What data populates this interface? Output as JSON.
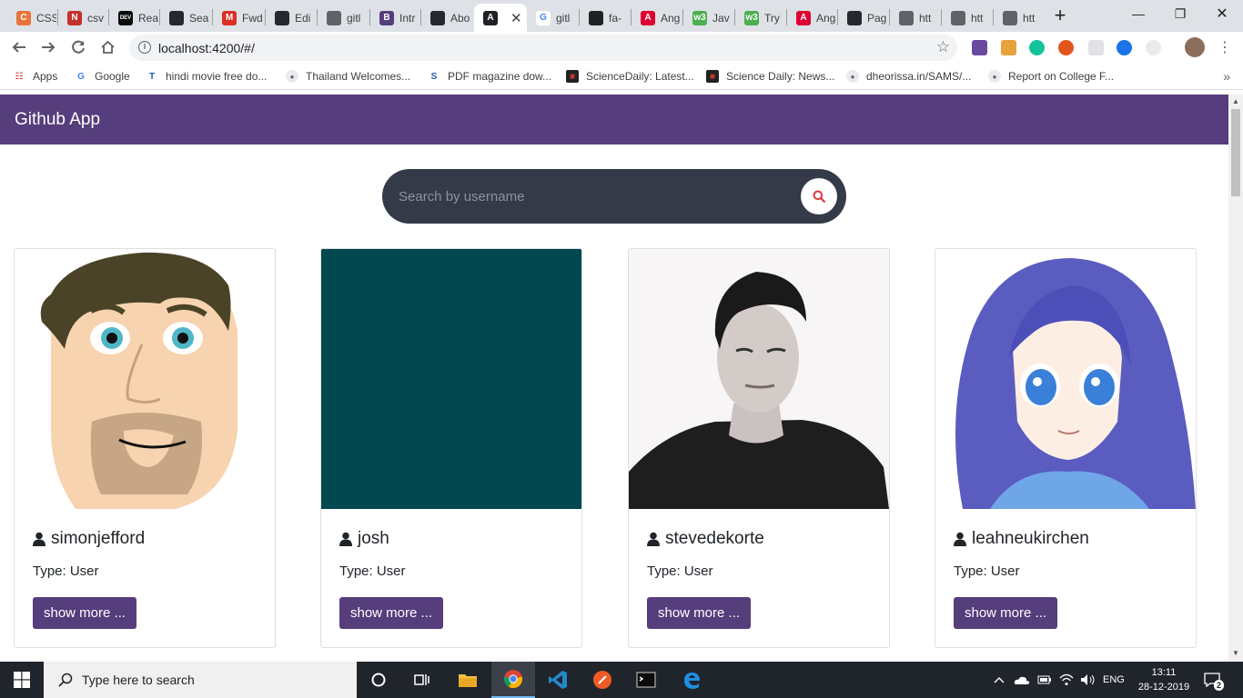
{
  "browser": {
    "tabs": [
      {
        "title": "CSS",
        "icon": "css-favicon",
        "color": "#e8743b"
      },
      {
        "title": "csv",
        "icon": "news-favicon",
        "color": "#c4302b"
      },
      {
        "title": "Rea",
        "icon": "dev-favicon",
        "color": "#0a0a0a"
      },
      {
        "title": "Sea",
        "icon": "github-favicon",
        "color": "#24292e"
      },
      {
        "title": "Fwd",
        "icon": "gmail-favicon",
        "color": "#d93025"
      },
      {
        "title": "Edi",
        "icon": "github-favicon",
        "color": "#24292e"
      },
      {
        "title": "gitl",
        "icon": "globe-favicon",
        "color": "#5f6368"
      },
      {
        "title": "Intr",
        "icon": "bootstrap-favicon",
        "color": "#563d7c"
      },
      {
        "title": "Abo",
        "icon": "github-favicon",
        "color": "#24292e"
      },
      {
        "title": "",
        "icon": "angular-favicon",
        "color": "#202124"
      },
      {
        "title": "gitl",
        "icon": "google-favicon",
        "color": "#4285f4"
      },
      {
        "title": "fa-",
        "icon": "flag-favicon",
        "color": "#202124"
      },
      {
        "title": "Ang",
        "icon": "angular-favicon",
        "color": "#dd0031"
      },
      {
        "title": "Jav",
        "icon": "w3schools-favicon",
        "color": "#4caf50"
      },
      {
        "title": "Try",
        "icon": "w3schools-favicon",
        "color": "#4caf50"
      },
      {
        "title": "Ang",
        "icon": "angular-favicon",
        "color": "#dd0031"
      },
      {
        "title": "Pag",
        "icon": "github-favicon",
        "color": "#24292e"
      },
      {
        "title": "htt",
        "icon": "globe-favicon",
        "color": "#5f6368"
      },
      {
        "title": "htt",
        "icon": "globe-favicon",
        "color": "#5f6368"
      },
      {
        "title": "htt",
        "icon": "globe-favicon",
        "color": "#5f6368"
      }
    ],
    "active_tab_index": 9,
    "url": "localhost:4200/#/",
    "bookmarks": [
      {
        "label": "Apps",
        "icon": "apps-grid-icon"
      },
      {
        "label": "Google",
        "icon": "google-icon"
      },
      {
        "label": "hindi movie free do...",
        "icon": "bookmark-tz-icon"
      },
      {
        "label": "Thailand Welcomes...",
        "icon": "globe-icon"
      },
      {
        "label": "PDF magazine dow...",
        "icon": "bookmark-s-icon"
      },
      {
        "label": "ScienceDaily: Latest...",
        "icon": "sciencedaily-icon"
      },
      {
        "label": "Science Daily: News...",
        "icon": "sciencedaily-icon"
      },
      {
        "label": "dheorissa.in/SAMS/...",
        "icon": "globe-icon"
      },
      {
        "label": "Report on College F...",
        "icon": "globe-icon"
      }
    ],
    "more_bookmarks": "»"
  },
  "app": {
    "title": "Github App",
    "accent_color": "#563d7c",
    "search": {
      "placeholder": "Search by username",
      "value": ""
    },
    "users": [
      {
        "username": "simonjefford",
        "type_label": "Type: User",
        "button": "show more ...",
        "avatar": "cartoon-face-avatar"
      },
      {
        "username": "josh",
        "type_label": "Type: User",
        "button": "show more ...",
        "avatar": "solid-teal-avatar"
      },
      {
        "username": "stevedekorte",
        "type_label": "Type: User",
        "button": "show more ...",
        "avatar": "photo-portrait-avatar"
      },
      {
        "username": "leahneukirchen",
        "type_label": "Type: User",
        "button": "show more ...",
        "avatar": "anime-girl-avatar"
      }
    ]
  },
  "taskbar": {
    "search_placeholder": "Type here to search",
    "language": "ENG",
    "time": "13:11",
    "date": "28-12-2019",
    "notification_count": "2"
  }
}
